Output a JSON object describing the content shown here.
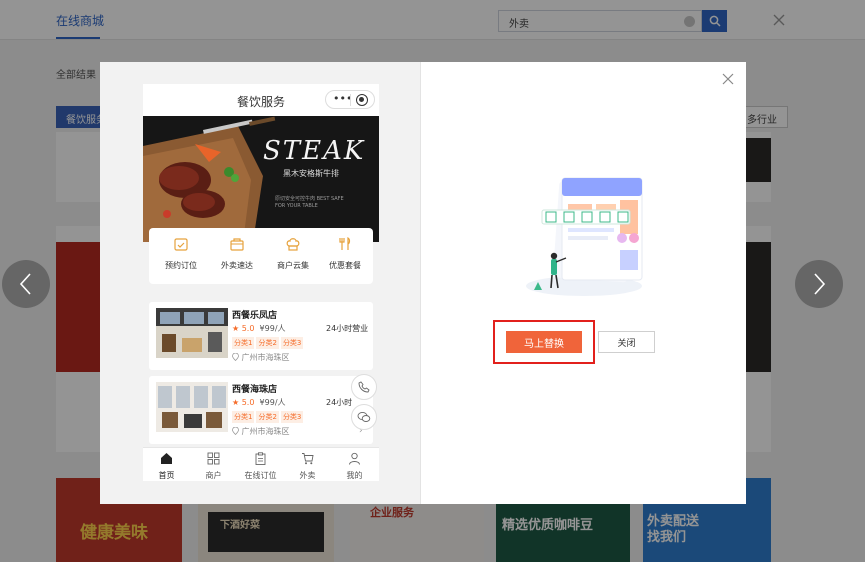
{
  "background": {
    "tab": "在线商城",
    "search_value": "外卖",
    "breadcrumb": "全部结果 >",
    "category_button": "餐饮服务",
    "more_industries": "多行业",
    "bottom_cards": [
      {
        "title": "健康美味"
      },
      {
        "title": "下酒好菜"
      },
      {
        "title": "企业服务"
      },
      {
        "title": "精选优质咖啡豆"
      },
      {
        "title": "外卖配送找我们"
      }
    ]
  },
  "modal": {
    "phone": {
      "title": "餐饮服务",
      "banner": {
        "headline": "STEAK",
        "subline": "黑木安格斯牛排",
        "small_text": "原切安全可控牛肉 BEST SAFE FOR YOUR TABLE"
      },
      "quick_actions": [
        {
          "label": "预约订位",
          "icon": "calendar-check-icon"
        },
        {
          "label": "外卖速达",
          "icon": "takeout-bag-icon"
        },
        {
          "label": "商户云集",
          "icon": "chef-hat-icon"
        },
        {
          "label": "优惠套餐",
          "icon": "cutlery-icon"
        }
      ],
      "stores": [
        {
          "name": "西餐乐凤店",
          "star": "★",
          "score": "5.0",
          "price": "¥99/人",
          "hours": "24小时营业",
          "tags": [
            "分类1",
            "分类2",
            "分类3"
          ],
          "address": "广州市海珠区"
        },
        {
          "name": "西餐海珠店",
          "star": "★",
          "score": "5.0",
          "price": "¥99/人",
          "hours": "24小时",
          "tags": [
            "分类1",
            "分类2",
            "分类3"
          ],
          "address": "广州市海珠区"
        }
      ],
      "tabbar": [
        {
          "label": "首页",
          "icon": "home-icon"
        },
        {
          "label": "商户",
          "icon": "grid-icon"
        },
        {
          "label": "在线订位",
          "icon": "clipboard-icon"
        },
        {
          "label": "外卖",
          "icon": "cart-icon"
        },
        {
          "label": "我的",
          "icon": "user-icon"
        }
      ]
    },
    "primary_button": "马上替换",
    "secondary_button": "关闭"
  },
  "colors": {
    "accent": "#f0643a",
    "highlight_border": "#e2201c",
    "brand_blue": "#2f66c7"
  }
}
